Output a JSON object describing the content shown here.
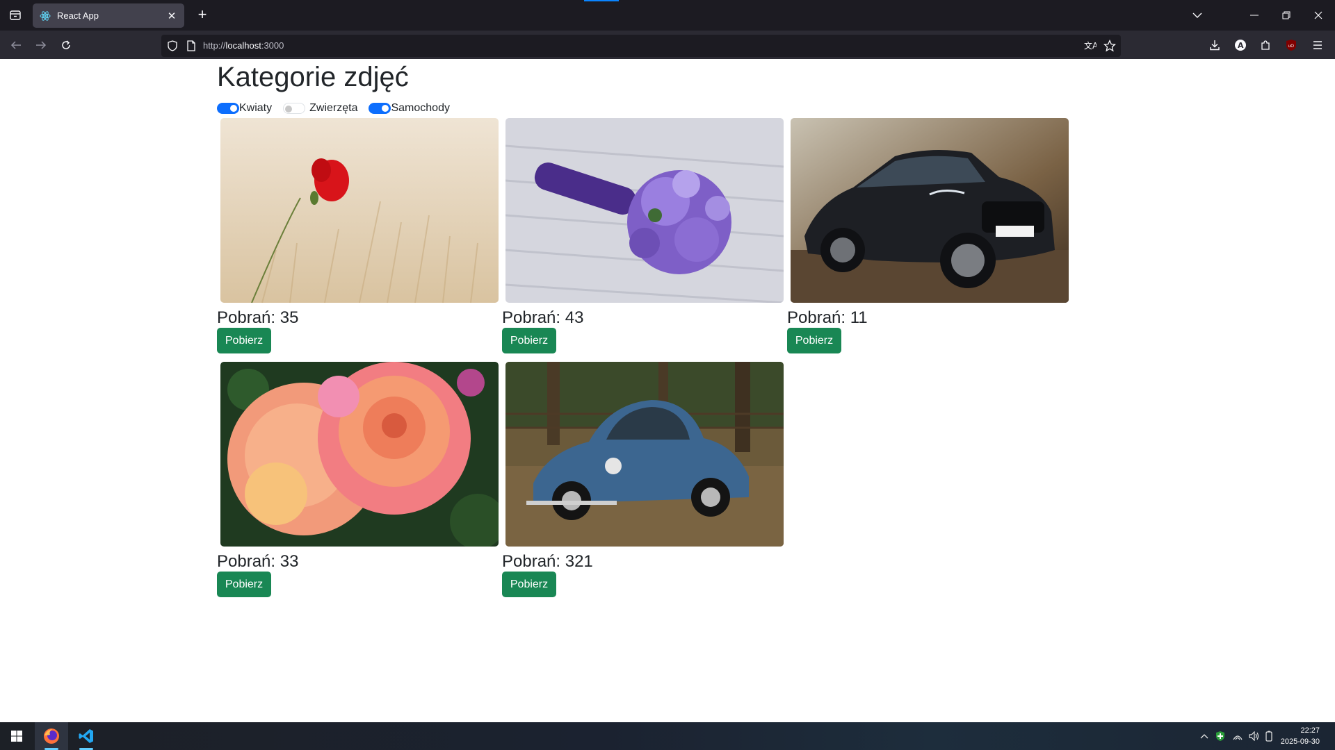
{
  "browser": {
    "tab_title": "React App",
    "url_prefix": "http://",
    "url_host": "localhost",
    "url_port": ":3000"
  },
  "page": {
    "title": "Kategorie zdjęć",
    "filters": [
      {
        "label": "Kwiaty",
        "checked": true
      },
      {
        "label": "Zwierzęta",
        "checked": false
      },
      {
        "label": "Samochody",
        "checked": true
      }
    ],
    "download_label": "Pobierz",
    "cards": [
      {
        "image": "red-poppy-in-wheat-field",
        "downloads_text": "Pobrań: 35"
      },
      {
        "image": "purple-flower-bouquet",
        "downloads_text": "Pobrań: 43"
      },
      {
        "image": "black-audi-car",
        "downloads_text": "Pobrań: 11"
      },
      {
        "image": "orange-pink-roses",
        "downloads_text": "Pobrań: 33"
      },
      {
        "image": "blue-vw-beetle",
        "downloads_text": "Pobrań: 321"
      }
    ]
  },
  "taskbar": {
    "time": "22:27",
    "date": "2025-09-30"
  },
  "colors": {
    "switch_on": "#0d6efd",
    "download_button": "#198754",
    "browser_chrome": "#1c1b22"
  }
}
